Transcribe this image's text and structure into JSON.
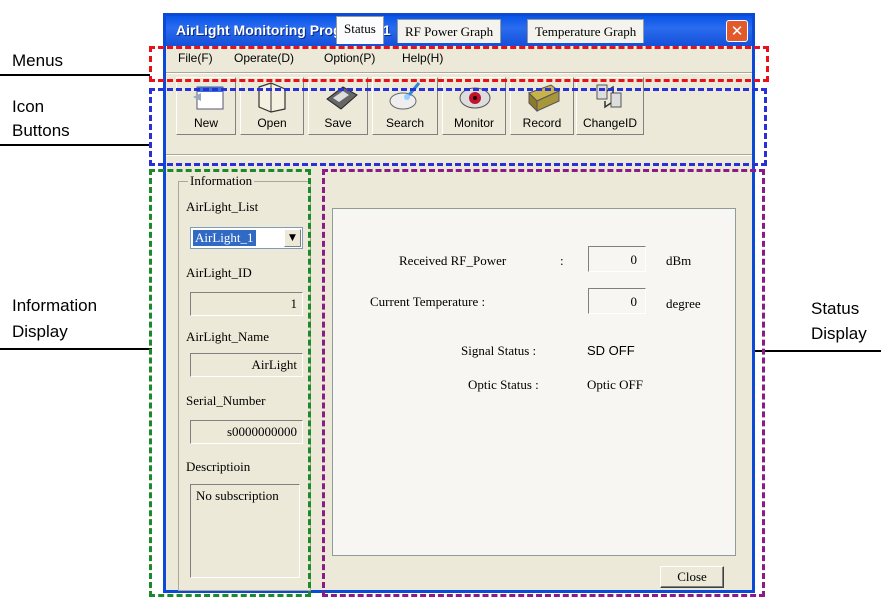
{
  "annotations": {
    "menus": "Menus",
    "icon_buttons_1": "Icon",
    "icon_buttons_2": "Buttons",
    "info_display_1": "Information",
    "info_display_2": "Display",
    "status_display_1": "Status",
    "status_display_2": "Display",
    "colors": {
      "menus": "#e8101a",
      "icons": "#2830d8",
      "info": "#1c8a2a",
      "status": "#8a1c8a"
    }
  },
  "window": {
    "title": "AirLight Monitoring Program_v1",
    "close_glyph": "✕"
  },
  "menu": {
    "items": [
      {
        "label": "File(F)",
        "shortcut": "F"
      },
      {
        "label": "Operate(D)",
        "shortcut": "D"
      },
      {
        "label": "Option(P)",
        "shortcut": "P"
      },
      {
        "label": "Help(H)",
        "shortcut": "H"
      }
    ]
  },
  "toolbar": {
    "buttons": [
      {
        "label": "New",
        "icon": "new-window-icon"
      },
      {
        "label": "Open",
        "icon": "folder-open-icon"
      },
      {
        "label": "Save",
        "icon": "floppy-disk-icon"
      },
      {
        "label": "Search",
        "icon": "magnifier-icon"
      },
      {
        "label": "Monitor",
        "icon": "monitor-eye-icon"
      },
      {
        "label": "Record",
        "icon": "record-file-icon"
      },
      {
        "label": "ChangeID",
        "icon": "change-id-icon"
      }
    ]
  },
  "information": {
    "legend": "Information",
    "list_label": "AirLight_List",
    "list_value": "AirLight_1",
    "id_label": "AirLight_ID",
    "id_value": "1",
    "name_label": "AirLight_Name",
    "name_value": "AirLight",
    "serial_label": "Serial_Number",
    "serial_value": "s0000000000",
    "desc_label": "Descriptioin",
    "desc_value": "No subscription"
  },
  "tabs": {
    "items": [
      "Status",
      "RF Power Graph",
      "Temperature Graph"
    ],
    "active": "Status"
  },
  "status": {
    "rf_power_label": "Received RF_Power",
    "rf_power_colon": ":",
    "rf_power_value": "0",
    "rf_power_unit": "dBm",
    "temp_label": "Current Temperature :",
    "temp_value": "0",
    "temp_unit": "degree",
    "signal_label": "Signal Status :",
    "signal_value": "SD OFF",
    "optic_label": "Optic Status :",
    "optic_value": "Optic OFF"
  },
  "footer": {
    "close_label": "Close"
  }
}
